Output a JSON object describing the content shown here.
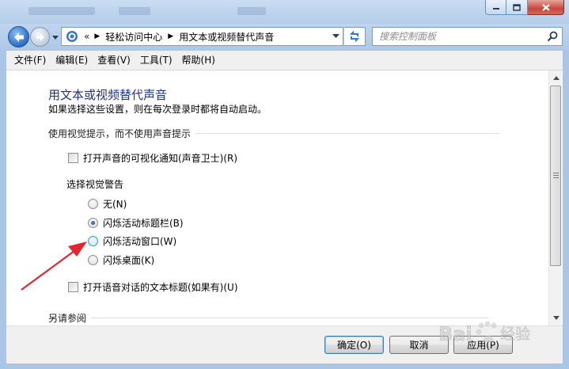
{
  "window": {
    "breadcrumb_root": "轻松访问中心",
    "breadcrumb_current": "用文本或视频替代声音",
    "breadcrumb_prefix": "«",
    "search_placeholder": "搜索控制面板"
  },
  "menu": [
    "文件(F)",
    "编辑(E)",
    "查看(V)",
    "工具(T)",
    "帮助(H)"
  ],
  "page": {
    "title": "用文本或视频替代声音",
    "description": "如果选择这些设置，则在每次登录时都将自动启动。",
    "section_visual": "使用视觉提示，而不使用声音提示",
    "checkbox_sound_sentry": "打开声音的可视化通知(声音卫士)(R)",
    "sound_sentry_checked": false,
    "visual_warning_label": "选择视觉警告",
    "radio_options": [
      {
        "label": "无(N)",
        "checked": false
      },
      {
        "label": "闪烁活动标题栏(B)",
        "checked": true
      },
      {
        "label": "闪烁活动窗口(W)",
        "checked": false
      },
      {
        "label": "闪烁桌面(K)",
        "checked": false
      }
    ],
    "checkbox_captions": "打开语音对话的文本标题(如果有)(U)",
    "captions_checked": false,
    "section_see_also": "另请参阅"
  },
  "buttons": {
    "ok": "确定(O)",
    "cancel": "取消",
    "apply": "应用(P)"
  },
  "watermark": {
    "text": "Bai 经验"
  },
  "colors": {
    "title_blue": "#1e3287",
    "annotation_arrow": "#e3262e"
  }
}
